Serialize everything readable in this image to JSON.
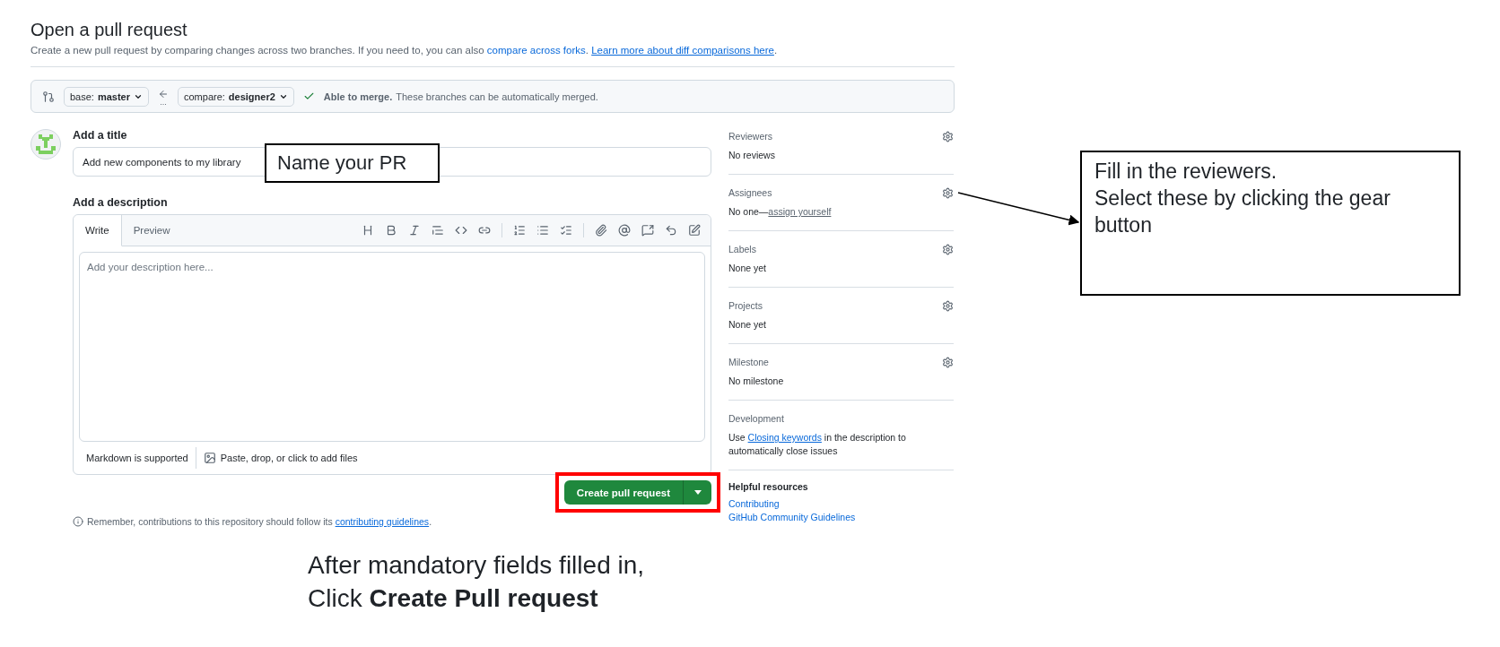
{
  "header": {
    "title": "Open a pull request",
    "subtitle": [
      {
        "kind": "text",
        "text": "Create a new pull request by comparing changes across two branches. If you need to, you can also "
      },
      {
        "kind": "link",
        "text": "compare across forks"
      },
      {
        "kind": "text",
        "text": ". "
      },
      {
        "kind": "underlined_link",
        "text": "Learn more about diff comparisons here"
      },
      {
        "kind": "text",
        "text": "."
      }
    ]
  },
  "merge_bar": {
    "base": {
      "label": "base:",
      "value": "master"
    },
    "compare": {
      "label": "compare:",
      "value": "designer2"
    },
    "dots": "...",
    "status": "**Able to merge.** These branches can be automatically merged."
  },
  "form": {
    "title_label": "Add a title",
    "title_value": "Add new components to my library",
    "description_label": "Add a description",
    "tabs": [
      {
        "label": "Write",
        "selected": true
      },
      {
        "label": "Preview",
        "selected": false
      }
    ],
    "placeholder": "Add your description here...",
    "footer": [
      "Markdown is supported",
      "Paste, drop, or click to add files"
    ],
    "submit": "Create pull request",
    "note": [
      {
        "kind": "text",
        "text": "Remember, contributions to this repository should follow its "
      },
      {
        "kind": "underlined_link",
        "text": "contributing guidelines"
      },
      {
        "kind": "text",
        "text": "."
      }
    ]
  },
  "sidebar": {
    "sections": [
      {
        "heading": "Reviewers",
        "gear": true,
        "value": [
          {
            "kind": "text",
            "text": "No reviews"
          }
        ]
      },
      {
        "heading": "Assignees",
        "gear": true,
        "value": [
          {
            "kind": "text",
            "text": "No one—"
          },
          {
            "kind": "muted_link",
            "text": "assign yourself"
          }
        ]
      },
      {
        "heading": "Labels",
        "gear": true,
        "value": [
          {
            "kind": "text",
            "text": "None yet"
          }
        ]
      },
      {
        "heading": "Projects",
        "gear": true,
        "value": [
          {
            "kind": "text",
            "text": "None yet"
          }
        ]
      },
      {
        "heading": "Milestone",
        "gear": true,
        "value": [
          {
            "kind": "text",
            "text": "No milestone"
          }
        ]
      },
      {
        "heading": "Development",
        "gear": false,
        "value": [
          {
            "kind": "text",
            "text": "Use "
          },
          {
            "kind": "underlined_link",
            "text": "Closing keywords"
          },
          {
            "kind": "text",
            "text": " in the description to automatically close issues"
          }
        ]
      }
    ],
    "resources": {
      "heading": "Helpful resources",
      "links": [
        "Contributing",
        "GitHub Community Guidelines"
      ]
    }
  },
  "annotations": {
    "title_callout": "Name your PR",
    "reviewers_callout": [
      "Fill in the reviewers.",
      "Select these by clicking the gear button"
    ],
    "button_callout": [
      "After mandatory fields filled in,",
      "Click **Create Pull request**"
    ]
  }
}
